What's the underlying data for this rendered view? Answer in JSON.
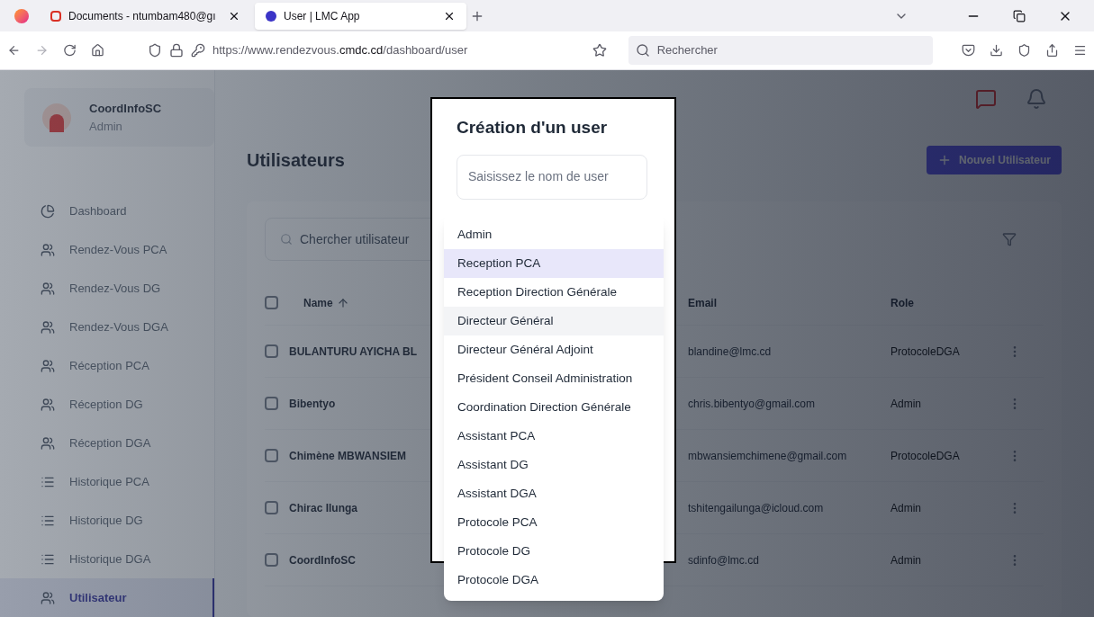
{
  "browser": {
    "tabs": [
      {
        "title": "Documents - ntumbam480@gı",
        "selected": false
      },
      {
        "title": "User | LMC App",
        "selected": true
      }
    ],
    "url": {
      "prefix": "https://www.rendezvous.",
      "domain": "cmdc.cd",
      "path": "/dashboard/user"
    },
    "search_placeholder": "Rechercher"
  },
  "profile": {
    "name": "CoordInfoSC",
    "role": "Admin"
  },
  "sidebar": {
    "items": [
      {
        "label": "Dashboard",
        "kind": "chart",
        "selected": false
      },
      {
        "label": "Rendez-Vous PCA",
        "kind": "users",
        "selected": false
      },
      {
        "label": "Rendez-Vous DG",
        "kind": "users",
        "selected": false
      },
      {
        "label": "Rendez-Vous DGA",
        "kind": "users",
        "selected": false
      },
      {
        "label": "Réception PCA",
        "kind": "users",
        "selected": false
      },
      {
        "label": "Réception DG",
        "kind": "users",
        "selected": false
      },
      {
        "label": "Réception DGA",
        "kind": "users",
        "selected": false
      },
      {
        "label": "Historique PCA",
        "kind": "list",
        "selected": false
      },
      {
        "label": "Historique DG",
        "kind": "list",
        "selected": false
      },
      {
        "label": "Historique DGA",
        "kind": "list",
        "selected": false
      },
      {
        "label": "Utilisateur",
        "kind": "users",
        "selected": true
      }
    ]
  },
  "page": {
    "title": "Utilisateurs",
    "new_button": "Nouvel Utilisateur",
    "search_placeholder": "Chercher utilisateur"
  },
  "table": {
    "columns": [
      "Name",
      "Email",
      "Role"
    ],
    "header_checked": false,
    "rows": [
      {
        "name": "BULANTURU AYICHA BL",
        "email": "blandine@lmc.cd",
        "role": "ProtocoleDGA",
        "checked": false
      },
      {
        "name": "Bibentyo",
        "email": "chris.bibentyo@gmail.com",
        "role": "Admin",
        "checked": false
      },
      {
        "name": "Chimène MBWANSIEM",
        "email": "mbwansiemchimene@gmail.com",
        "role": "ProtocoleDGA",
        "checked": false
      },
      {
        "name": "Chirac Ilunga",
        "email": "tshitengailunga@icloud.com",
        "role": "Admin",
        "checked": false
      },
      {
        "name": "CoordInfoSC",
        "email": "sdinfo@lmc.cd",
        "role": "Admin",
        "checked": false
      }
    ]
  },
  "modal": {
    "title": "Création d'un user",
    "name_placeholder": "Saisissez le nom de user",
    "options": [
      {
        "label": "Admin",
        "selected": false,
        "hovered": false
      },
      {
        "label": "Reception PCA",
        "selected": true,
        "hovered": false
      },
      {
        "label": "Reception Direction Générale",
        "selected": false,
        "hovered": false
      },
      {
        "label": "Directeur Général",
        "selected": false,
        "hovered": true
      },
      {
        "label": "Directeur Général Adjoint",
        "selected": false,
        "hovered": false
      },
      {
        "label": "Président Conseil Administration",
        "selected": false,
        "hovered": false
      },
      {
        "label": "Coordination Direction Générale",
        "selected": false,
        "hovered": false
      },
      {
        "label": "Assistant PCA",
        "selected": false,
        "hovered": false
      },
      {
        "label": "Assistant DG",
        "selected": false,
        "hovered": false
      },
      {
        "label": "Assistant DGA",
        "selected": false,
        "hovered": false
      },
      {
        "label": "Protocole PCA",
        "selected": false,
        "hovered": false
      },
      {
        "label": "Protocole DG",
        "selected": false,
        "hovered": false
      },
      {
        "label": "Protocole DGA",
        "selected": false,
        "hovered": false
      }
    ]
  }
}
